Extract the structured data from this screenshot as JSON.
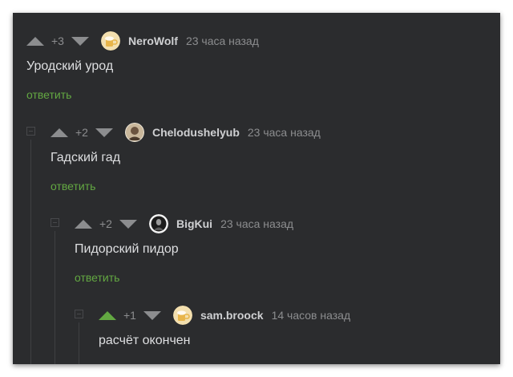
{
  "comments": [
    {
      "score": "+3",
      "author": "NeroWolf",
      "time": "23 часа назад",
      "text": "Уродский урод",
      "reply_label": "ответить",
      "avatar_icon": "beer-mug-icon"
    },
    {
      "score": "+2",
      "author": "Chelodushelyub",
      "time": "23 часа назад",
      "text": "Гадский гад",
      "reply_label": "ответить",
      "avatar_icon": "portrait-icon"
    },
    {
      "score": "+2",
      "author": "BigKui",
      "time": "23 часа назад",
      "text": "Пидорский пидор",
      "reply_label": "ответить",
      "avatar_icon": "dark-portrait-icon"
    },
    {
      "score": "+1",
      "author": "sam.broock",
      "time": "14 часов назад",
      "text": "расчёт окончен",
      "reply_label": "",
      "avatar_icon": "beer-mug-icon",
      "upvoted": true
    }
  ],
  "colors": {
    "background": "#2b2c2e",
    "accent_green": "#63a842",
    "muted": "#8c8d8f"
  }
}
